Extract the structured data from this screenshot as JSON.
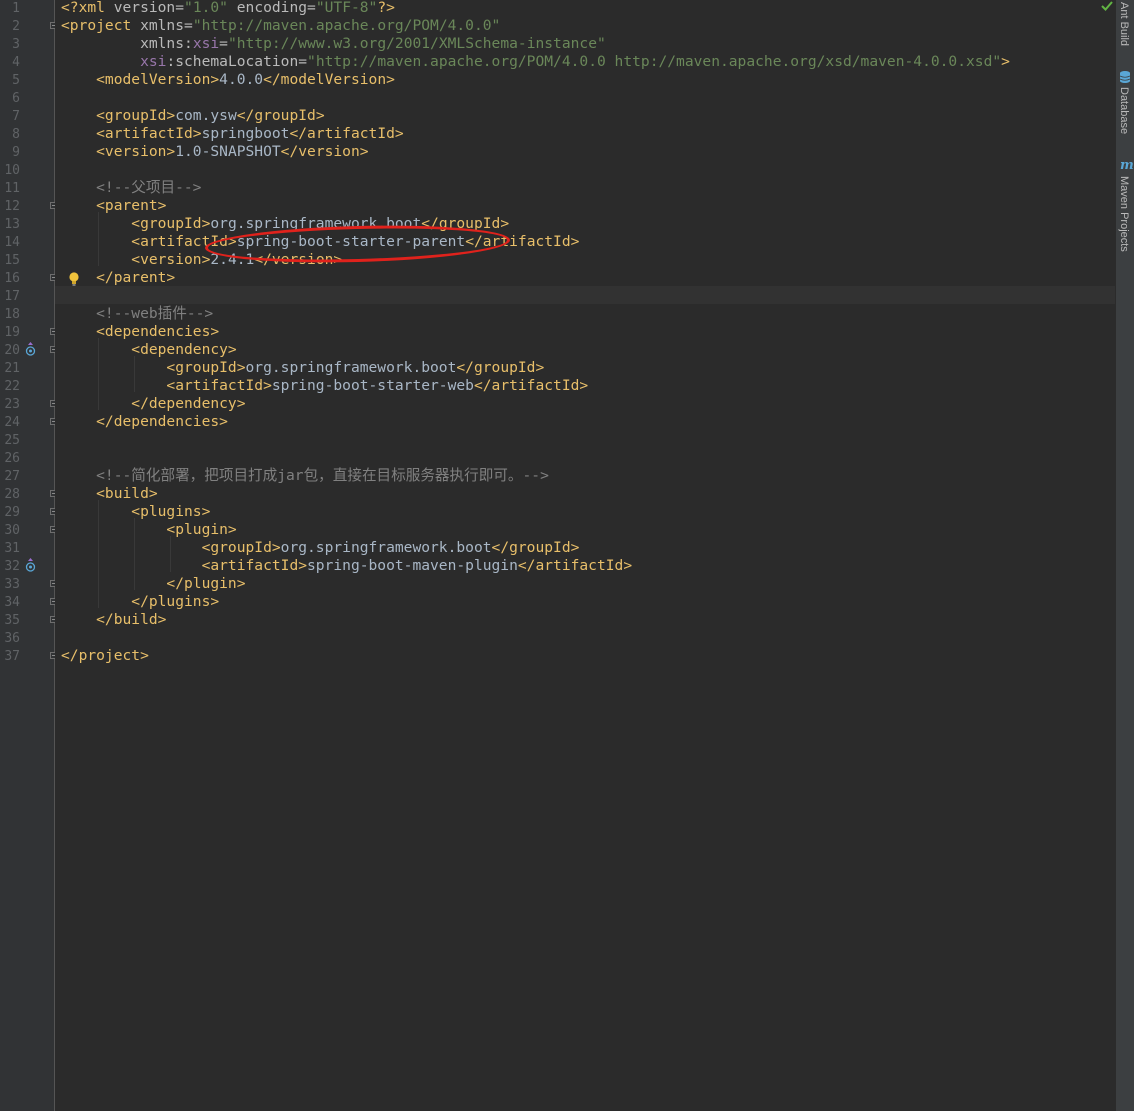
{
  "editor": {
    "lines": [
      {
        "n": "1",
        "segs": [
          {
            "t": "<?xml ",
            "c": "tag"
          },
          {
            "t": "version",
            "c": "attr"
          },
          {
            "t": "=",
            "c": "attr"
          },
          {
            "t": "\"1.0\"",
            "c": "val"
          },
          {
            "t": " encoding",
            "c": "attr"
          },
          {
            "t": "=",
            "c": "attr"
          },
          {
            "t": "\"UTF-8\"",
            "c": "val"
          },
          {
            "t": "?>",
            "c": "tag"
          }
        ]
      },
      {
        "n": "2",
        "segs": [
          {
            "t": "<project ",
            "c": "tag"
          },
          {
            "t": "xmlns",
            "c": "attr"
          },
          {
            "t": "=",
            "c": "attr"
          },
          {
            "t": "\"http://maven.apache.org/POM/4.0.0\"",
            "c": "val"
          }
        ]
      },
      {
        "n": "3",
        "segs": [
          {
            "t": "         xmlns",
            "c": "attr"
          },
          {
            "t": ":",
            "c": "attr"
          },
          {
            "t": "xsi",
            "c": "ns"
          },
          {
            "t": "=",
            "c": "attr"
          },
          {
            "t": "\"http://www.w3.org/2001/XMLSchema-instance\"",
            "c": "val"
          }
        ]
      },
      {
        "n": "4",
        "segs": [
          {
            "t": "         ",
            "c": "attr"
          },
          {
            "t": "xsi",
            "c": "ns"
          },
          {
            "t": ":schemaLocation",
            "c": "attr"
          },
          {
            "t": "=",
            "c": "attr"
          },
          {
            "t": "\"http://maven.apache.org/POM/4.0.0 http://maven.apache.org/xsd/maven-4.0.0.xsd\"",
            "c": "val"
          },
          {
            "t": ">",
            "c": "tag"
          }
        ]
      },
      {
        "n": "5",
        "segs": [
          {
            "t": "    <modelVersion>",
            "c": "tag"
          },
          {
            "t": "4.0.0",
            "c": "text"
          },
          {
            "t": "</modelVersion>",
            "c": "tag"
          }
        ]
      },
      {
        "n": "6",
        "segs": []
      },
      {
        "n": "7",
        "segs": [
          {
            "t": "    <groupId>",
            "c": "tag"
          },
          {
            "t": "com.ysw",
            "c": "text"
          },
          {
            "t": "</groupId>",
            "c": "tag"
          }
        ]
      },
      {
        "n": "8",
        "segs": [
          {
            "t": "    <artifactId>",
            "c": "tag"
          },
          {
            "t": "springboot",
            "c": "text"
          },
          {
            "t": "</artifactId>",
            "c": "tag"
          }
        ]
      },
      {
        "n": "9",
        "segs": [
          {
            "t": "    <version>",
            "c": "tag"
          },
          {
            "t": "1.0-SNAPSHOT",
            "c": "text"
          },
          {
            "t": "</version>",
            "c": "tag"
          }
        ]
      },
      {
        "n": "10",
        "segs": []
      },
      {
        "n": "11",
        "segs": [
          {
            "t": "    <!--父项目-->",
            "c": "com"
          }
        ]
      },
      {
        "n": "12",
        "segs": [
          {
            "t": "    <parent>",
            "c": "tag"
          }
        ]
      },
      {
        "n": "13",
        "segs": [
          {
            "t": "        <groupId>",
            "c": "tag"
          },
          {
            "t": "org.springframework.boot",
            "c": "text"
          },
          {
            "t": "</groupId>",
            "c": "tag"
          }
        ]
      },
      {
        "n": "14",
        "segs": [
          {
            "t": "        <artifactId>",
            "c": "tag"
          },
          {
            "t": "spring-boot-starter-parent",
            "c": "text"
          },
          {
            "t": "</artifactId>",
            "c": "tag"
          }
        ]
      },
      {
        "n": "15",
        "segs": [
          {
            "t": "        <version>",
            "c": "tag"
          },
          {
            "t": "2.4.1",
            "c": "text"
          },
          {
            "t": "</version>",
            "c": "tag"
          }
        ]
      },
      {
        "n": "16",
        "segs": [
          {
            "t": "    </parent>",
            "c": "tag"
          }
        ]
      },
      {
        "n": "17",
        "segs": []
      },
      {
        "n": "18",
        "segs": [
          {
            "t": "    <!--web插件-->",
            "c": "com"
          }
        ]
      },
      {
        "n": "19",
        "segs": [
          {
            "t": "    <dependencies>",
            "c": "tag"
          }
        ]
      },
      {
        "n": "20",
        "segs": [
          {
            "t": "        <dependency>",
            "c": "tag"
          }
        ]
      },
      {
        "n": "21",
        "segs": [
          {
            "t": "            <groupId>",
            "c": "tag"
          },
          {
            "t": "org.springframework.boot",
            "c": "text"
          },
          {
            "t": "</groupId>",
            "c": "tag"
          }
        ]
      },
      {
        "n": "22",
        "segs": [
          {
            "t": "            <artifactId>",
            "c": "tag"
          },
          {
            "t": "spring-boot-starter-web",
            "c": "text"
          },
          {
            "t": "</artifactId>",
            "c": "tag"
          }
        ]
      },
      {
        "n": "23",
        "segs": [
          {
            "t": "        </dependency>",
            "c": "tag"
          }
        ]
      },
      {
        "n": "24",
        "segs": [
          {
            "t": "    </dependencies>",
            "c": "tag"
          }
        ]
      },
      {
        "n": "25",
        "segs": []
      },
      {
        "n": "26",
        "segs": []
      },
      {
        "n": "27",
        "segs": [
          {
            "t": "    <!--简化部署，把项目打成jar包，直接在目标服务器执行即可。-->",
            "c": "com"
          }
        ]
      },
      {
        "n": "28",
        "segs": [
          {
            "t": "    <build>",
            "c": "tag"
          }
        ]
      },
      {
        "n": "29",
        "segs": [
          {
            "t": "        <plugins>",
            "c": "tag"
          }
        ]
      },
      {
        "n": "30",
        "segs": [
          {
            "t": "            <plugin>",
            "c": "tag"
          }
        ]
      },
      {
        "n": "31",
        "segs": [
          {
            "t": "                <groupId>",
            "c": "tag"
          },
          {
            "t": "org.springframework.boot",
            "c": "text"
          },
          {
            "t": "</groupId>",
            "c": "tag"
          }
        ]
      },
      {
        "n": "32",
        "segs": [
          {
            "t": "                <artifactId>",
            "c": "tag"
          },
          {
            "t": "spring-boot-maven-plugin",
            "c": "text"
          },
          {
            "t": "</artifactId>",
            "c": "tag"
          }
        ]
      },
      {
        "n": "33",
        "segs": [
          {
            "t": "            </plugin>",
            "c": "tag"
          }
        ]
      },
      {
        "n": "34",
        "segs": [
          {
            "t": "        </plugins>",
            "c": "tag"
          }
        ]
      },
      {
        "n": "35",
        "segs": [
          {
            "t": "    </build>",
            "c": "tag"
          }
        ]
      },
      {
        "n": "36",
        "segs": []
      },
      {
        "n": "37",
        "segs": [
          {
            "t": "</project>",
            "c": "tag"
          }
        ]
      }
    ]
  },
  "right_panel": {
    "tabs": [
      {
        "label": "Ant Build",
        "icon": "ant-icon"
      },
      {
        "label": "Database",
        "icon": "database-icon"
      },
      {
        "label": "Maven Projects",
        "icon": "maven-icon"
      }
    ]
  },
  "colors": {
    "tag": "#e8bf6a",
    "attr": "#bababa",
    "namespace": "#9876aa",
    "value": "#6a8759",
    "text": "#a9b7c6",
    "comment": "#808080",
    "annotation": "#e0221c"
  },
  "status": {
    "inspection": "check-icon"
  }
}
